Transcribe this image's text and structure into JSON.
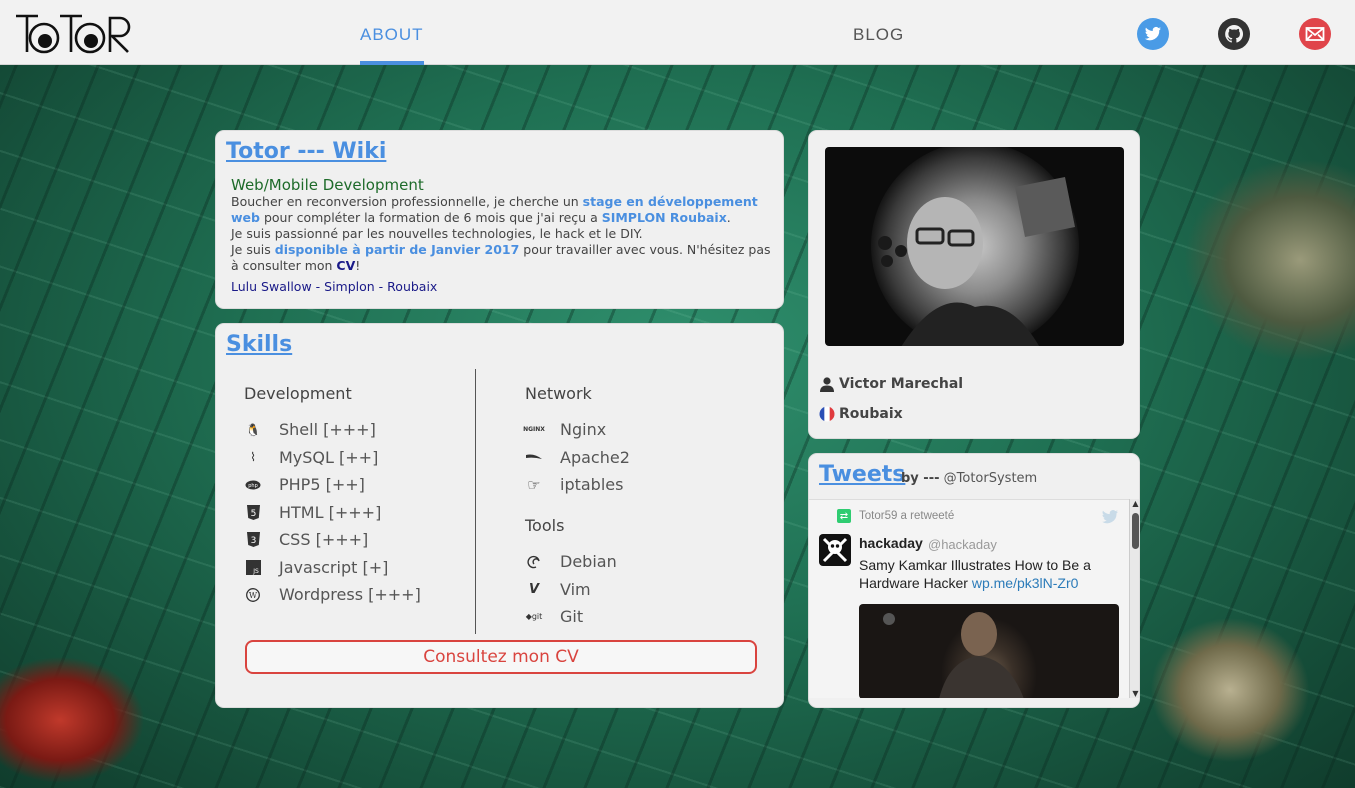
{
  "header": {
    "nav": [
      {
        "label": "ABOUT",
        "active": true
      },
      {
        "label": "BLOG",
        "active": false
      }
    ],
    "social": [
      {
        "icon": "twitter-icon",
        "color": "#4a9be6"
      },
      {
        "icon": "github-icon",
        "color": "#333333"
      },
      {
        "icon": "mail-icon",
        "color": "#e0444a"
      }
    ]
  },
  "wiki": {
    "title": "Totor --- Wiki",
    "subtitle": "Web/Mobile Development",
    "p1_a": "Boucher en reconversion professionnelle, je cherche un ",
    "p1_link": "stage en développement web",
    "p1_b": " pour compléter la formation de 6 mois que j'ai reçu a ",
    "p1_link2": "SIMPLON Roubaix",
    "p1_c": ".",
    "p2": "Je suis passionné par les nouvelles technologies, le hack et le DIY.",
    "p3_a": "Je suis ",
    "p3_link": "disponible à partir de Janvier 2017",
    "p3_b": " pour travailler avec vous. N'hésitez pas à consulter mon ",
    "p3_link2": "CV",
    "p3_c": "!",
    "links": [
      "Lulu Swallow",
      "Simplon",
      "Roubaix"
    ],
    "link_sep": " - "
  },
  "skills": {
    "title": "Skills",
    "development": {
      "heading": "Development",
      "items": [
        {
          "label": "Shell [+++]",
          "icon": "linux-icon"
        },
        {
          "label": "MySQL [++]",
          "icon": "mysql-icon"
        },
        {
          "label": "PHP5 [++]",
          "icon": "php-icon"
        },
        {
          "label": "HTML [+++]",
          "icon": "html5-icon"
        },
        {
          "label": "CSS [+++]",
          "icon": "css3-icon"
        },
        {
          "label": "Javascript [+]",
          "icon": "javascript-icon"
        },
        {
          "label": "Wordpress [+++]",
          "icon": "wordpress-icon"
        }
      ]
    },
    "network": {
      "heading": "Network",
      "items": [
        {
          "label": "Nginx",
          "icon": "nginx-icon"
        },
        {
          "label": "Apache2",
          "icon": "apache-icon"
        },
        {
          "label": "iptables",
          "icon": "hand-pointing-icon"
        }
      ]
    },
    "tools": {
      "heading": "Tools",
      "items": [
        {
          "label": "Debian",
          "icon": "debian-icon"
        },
        {
          "label": "Vim",
          "icon": "vim-icon"
        },
        {
          "label": "Git",
          "icon": "git-icon"
        }
      ]
    },
    "cv_button": "Consultez mon CV"
  },
  "profile": {
    "name": "Victor Marechal",
    "city": "Roubaix"
  },
  "tweets": {
    "title": "Tweets",
    "by_label": "by ---",
    "by_handle": "@TotorSystem",
    "retweet_line": "Totor59 a retweeté",
    "author_name": "hackaday",
    "author_handle": "@hackaday",
    "text": "Samy Kamkar Illustrates How to Be a Hardware Hacker ",
    "text_link": "wp.me/pk3lN-Zr0"
  }
}
